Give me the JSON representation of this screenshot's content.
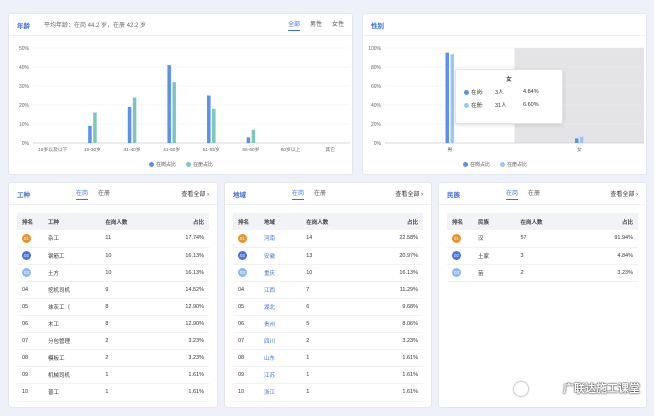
{
  "age": {
    "title": "年龄",
    "average": "平均年龄：在岗 44.2 岁，在册 42.2 岁",
    "filters": [
      "全部",
      "男性",
      "女性"
    ],
    "legend": [
      "在岗占比",
      "在册占比"
    ],
    "colors": {
      "onduty": "#5b8ff0",
      "registered": "#7cc5c0"
    }
  },
  "gender": {
    "title": "性别",
    "legend": [
      "在岗占比",
      "在册占比"
    ],
    "colors": {
      "onduty": "#5b8ff0",
      "registered": "#9ec5f7"
    },
    "tooltip": {
      "title": "女",
      "rows": [
        {
          "label": "在岗:",
          "count": "3人",
          "pct": "4.84%"
        },
        {
          "label": "在册:",
          "count": "31人",
          "pct": "6.60%"
        }
      ]
    }
  },
  "chart_data": [
    {
      "type": "bar",
      "categories": [
        "18岁以及以下",
        "19-30岁",
        "31-40岁",
        "41-50岁",
        "51-55岁",
        "55-60岁",
        "60岁以上",
        "其它"
      ],
      "series": [
        {
          "name": "在岗占比",
          "values": [
            0,
            9,
            19,
            41,
            25,
            3,
            0,
            0
          ]
        },
        {
          "name": "在册占比",
          "values": [
            0,
            16,
            24,
            32,
            18,
            7,
            0,
            0
          ]
        }
      ],
      "ylim": [
        0,
        50
      ],
      "yticks": [
        "0%",
        "10%",
        "20%",
        "30%",
        "40%",
        "50%"
      ]
    },
    {
      "type": "bar",
      "categories": [
        "男",
        "女"
      ],
      "series": [
        {
          "name": "在岗占比",
          "values": [
            95.16,
            4.84
          ]
        },
        {
          "name": "在册占比",
          "values": [
            93.4,
            6.6
          ]
        }
      ],
      "ylim": [
        0,
        100
      ],
      "yticks": [
        "0%",
        "20%",
        "40%",
        "60%",
        "80%",
        "100%"
      ]
    }
  ],
  "trade": {
    "title": "工种",
    "tabs": [
      "在岗",
      "在册"
    ],
    "view_all": "查看全部",
    "headers": [
      "排名",
      "工种",
      "在岗人数",
      "占比"
    ],
    "rows": [
      [
        "01",
        "杂工",
        "11",
        "17.74%"
      ],
      [
        "02",
        "钢筋工",
        "10",
        "16.13%"
      ],
      [
        "03",
        "土方",
        "10",
        "16.13%"
      ],
      [
        "04",
        "挖机司机",
        "9",
        "14.52%"
      ],
      [
        "05",
        "抹灰工（",
        "8",
        "12.90%"
      ],
      [
        "06",
        "木工",
        "8",
        "12.90%"
      ],
      [
        "07",
        "分包管理",
        "2",
        "3.23%"
      ],
      [
        "08",
        "模板工",
        "2",
        "3.23%"
      ],
      [
        "09",
        "机械司机",
        "1",
        "1.61%"
      ],
      [
        "10",
        "普工",
        "1",
        "1.61%"
      ]
    ]
  },
  "region": {
    "title": "地域",
    "tabs": [
      "在岗",
      "在册"
    ],
    "view_all": "查看全部",
    "headers": [
      "排名",
      "地域",
      "在岗人数",
      "占比"
    ],
    "rows": [
      [
        "01",
        "河南",
        "14",
        "22.58%"
      ],
      [
        "02",
        "安徽",
        "13",
        "20.97%"
      ],
      [
        "03",
        "重庆",
        "10",
        "16.13%"
      ],
      [
        "04",
        "江西",
        "7",
        "11.29%"
      ],
      [
        "05",
        "湖北",
        "6",
        "9.68%"
      ],
      [
        "06",
        "贵州",
        "5",
        "8.06%"
      ],
      [
        "07",
        "四川",
        "2",
        "3.23%"
      ],
      [
        "08",
        "山东",
        "1",
        "1.61%"
      ],
      [
        "09",
        "江苏",
        "1",
        "1.61%"
      ],
      [
        "10",
        "浙江",
        "1",
        "1.61%"
      ]
    ]
  },
  "ethnic": {
    "title": "民族",
    "tabs": [
      "在岗",
      "在册"
    ],
    "view_all": "查看全部",
    "headers": [
      "排名",
      "民族",
      "在岗人数",
      "占比"
    ],
    "rows": [
      [
        "01",
        "汉",
        "57",
        "91.94%"
      ],
      [
        "02",
        "土家",
        "3",
        "4.84%"
      ],
      [
        "03",
        "苗",
        "2",
        "3.23%"
      ]
    ]
  },
  "watermark": "广联达施工课堂"
}
